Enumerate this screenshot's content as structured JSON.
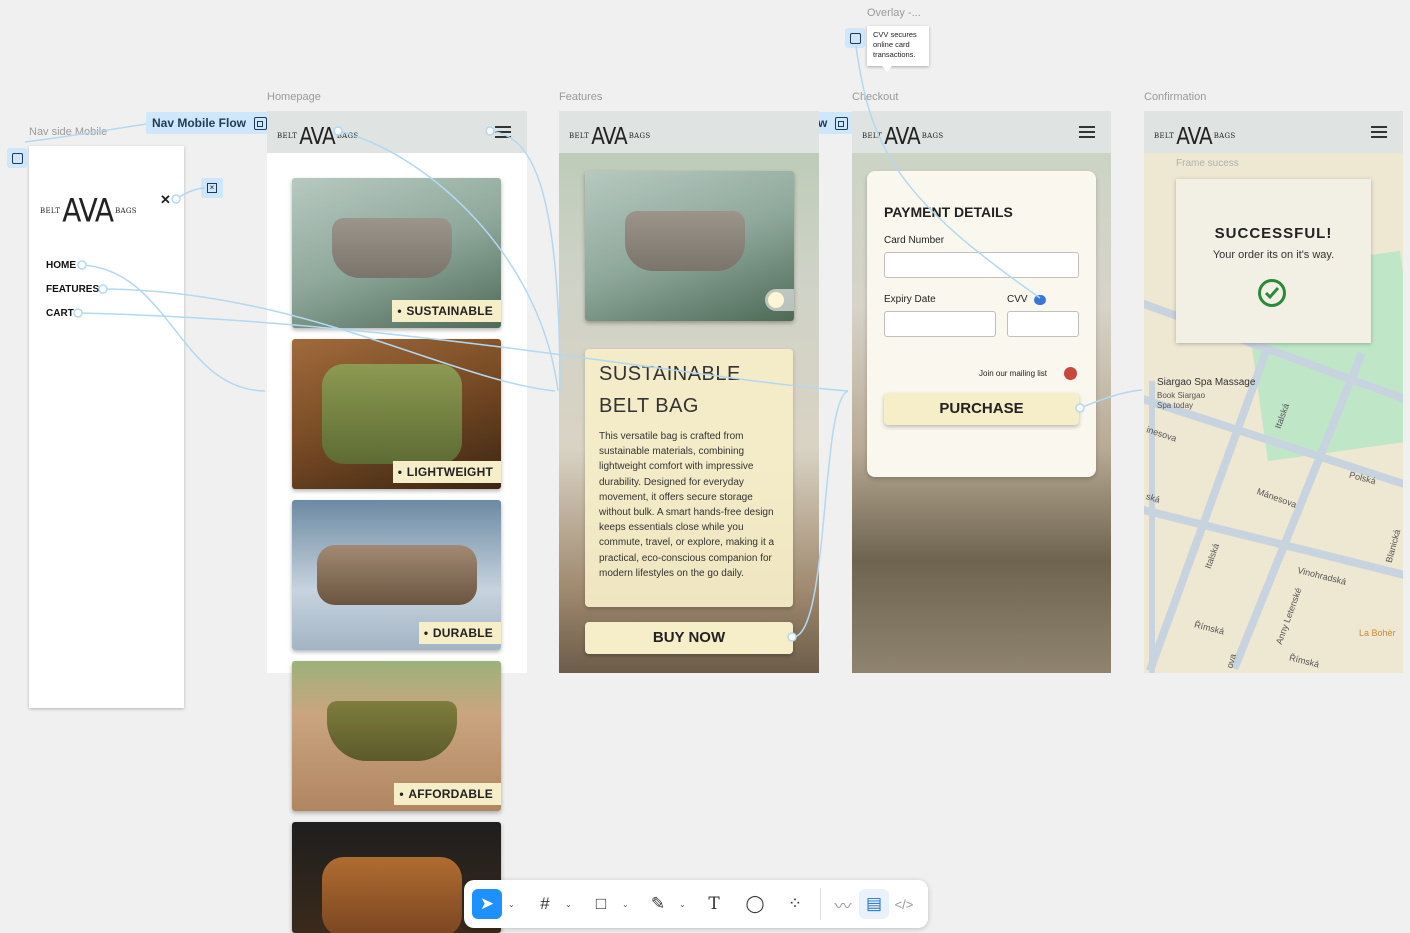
{
  "frames": {
    "nav": "Nav side Mobile",
    "home": "Homepage",
    "features": "Features",
    "checkout": "Checkout",
    "confirm": "Confirmation",
    "overlay": "Overlay -..."
  },
  "flows": {
    "nav_mobile": "Nav Mobile Flow",
    "cvv": "CVV Flow"
  },
  "overlay_tooltip": "CVV secures online card transactions.",
  "logo": {
    "left": "BELT",
    "main": "AVA",
    "right": "BAGS"
  },
  "nav_menu": {
    "items": [
      "HOME",
      "FEATURES",
      "CART"
    ],
    "close": "✕"
  },
  "home_cards": [
    "SUSTAINABLE",
    "LIGHTWEIGHT",
    "DURABLE",
    "AFFORDABLE"
  ],
  "features": {
    "title1": "SUSTAINABLE",
    "title2": "BELT BAG",
    "body": "This versatile bag is crafted from sustainable materials, combining lightweight comfort with impressive durability. Designed for everyday movement, it offers secure storage without bulk. A smart hands-free design keeps essentials close while you commute, travel, or explore, making it a practical, eco-conscious companion for modern lifestyles on the go daily.",
    "buy": "BUY NOW"
  },
  "checkout": {
    "title": "PAYMENT DETAILS",
    "card_number": "Card Number",
    "expiry": "Expiry Date",
    "cvv": "CVV",
    "mailing": "Join our mailing list",
    "purchase": "PURCHASE"
  },
  "confirmation": {
    "frame_label": "Frame sucess",
    "title": "SUCCESSFUL!",
    "subtitle": "Your order its on it's way.",
    "map": {
      "place": "Siargao Spa Massage",
      "place_sub1": "Book Siargao",
      "place_sub2": "Spa today",
      "streets": [
        "Italská",
        "Polská",
        "Mánesova",
        "Vinohradská",
        "Římská",
        "Římská",
        "Anny Letenské",
        "Blanická",
        "La Bohèr",
        "Italská",
        "inesova",
        "ská",
        "ova"
      ]
    }
  },
  "colors": {
    "accent": "#cfe6fb",
    "cream": "#f6eec9",
    "topbar": "#dfe4e2",
    "success": "#2a8a3a",
    "toggle_red": "#c9483c"
  }
}
